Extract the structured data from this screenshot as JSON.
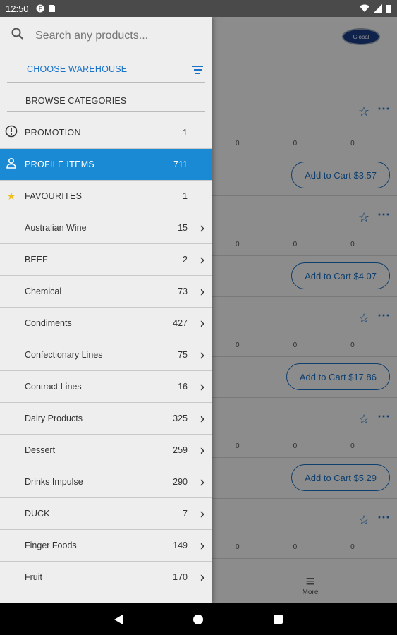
{
  "status": {
    "time": "12:50"
  },
  "search": {
    "placeholder": "Search any products..."
  },
  "warehouse": {
    "label": "CHOOSE WAREHOUSE"
  },
  "browse": {
    "label": "BROWSE CATEGORIES"
  },
  "categories": [
    {
      "label": "PROMOTION",
      "count": "1",
      "icon": "alert-circle-icon"
    },
    {
      "label": "PROFILE ITEMS",
      "count": "711",
      "icon": "person-icon",
      "selected": true
    },
    {
      "label": "FAVOURITES",
      "count": "1",
      "icon": "star-icon"
    },
    {
      "label": "Australian Wine",
      "count": "15"
    },
    {
      "label": "BEEF",
      "count": "2"
    },
    {
      "label": "Chemical",
      "count": "73"
    },
    {
      "label": "Condiments",
      "count": "427"
    },
    {
      "label": "Confectionary Lines",
      "count": "75"
    },
    {
      "label": "Contract Lines",
      "count": "16"
    },
    {
      "label": "Dairy Products",
      "count": "325"
    },
    {
      "label": "Dessert",
      "count": "259"
    },
    {
      "label": "Drinks Impulse",
      "count": "290"
    },
    {
      "label": "DUCK",
      "count": "7"
    },
    {
      "label": "Finger Foods",
      "count": "149"
    },
    {
      "label": "Fruit",
      "count": "170"
    }
  ],
  "background": {
    "cart_buttons": [
      "Add to Cart $3.57",
      "Add to Cart $4.07",
      "Add to Cart $17.86",
      "Add to Cart $5.29"
    ],
    "zero": "0",
    "more_label": "More",
    "logo_text": "Global"
  },
  "colors": {
    "accent": "#1a8ad4",
    "link": "#1a73c9"
  }
}
